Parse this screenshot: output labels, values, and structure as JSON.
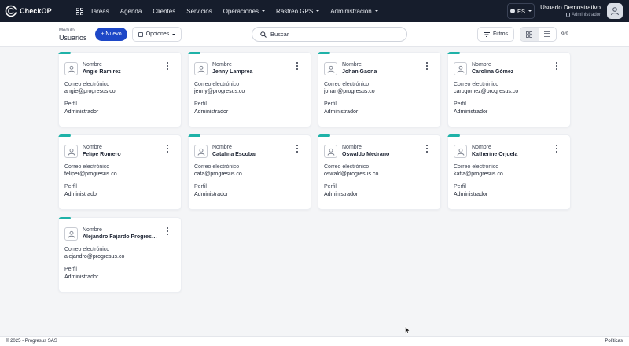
{
  "app": {
    "name": "CheckOP"
  },
  "nav": {
    "items": [
      {
        "label": "Tareas",
        "has_menu": false
      },
      {
        "label": "Agenda",
        "has_menu": false
      },
      {
        "label": "Clientes",
        "has_menu": false
      },
      {
        "label": "Servicios",
        "has_menu": false
      },
      {
        "label": "Operaciones",
        "has_menu": true
      },
      {
        "label": "Rastreo GPS",
        "has_menu": true
      },
      {
        "label": "Administración",
        "has_menu": true
      }
    ],
    "language": "ES",
    "user": {
      "name": "Usuario Demostrativo",
      "role": "Administrador"
    }
  },
  "toolbar": {
    "module_label": "Módulo",
    "module_title": "Usuarios",
    "new_label": "+ Nuevo",
    "options_label": "Opciones",
    "search_placeholder": "Buscar",
    "filters_label": "Filtros",
    "count": "9/9"
  },
  "card_labels": {
    "name": "Nombre",
    "email": "Correo electrónico",
    "profile": "Perfil"
  },
  "users": [
    {
      "name": "Angie Ramirez",
      "email": "angie@progresus.co",
      "profile": "Administrador"
    },
    {
      "name": "Jenny Lamprea",
      "email": "jenny@progresus.co",
      "profile": "Administrador"
    },
    {
      "name": "Johan Gaona",
      "email": "johan@progresus.co",
      "profile": "Administrador"
    },
    {
      "name": "Carolina Gómez",
      "email": "carogomez@progresus.co",
      "profile": "Administrador"
    },
    {
      "name": "Felipe Romero",
      "email": "feliper@progresus.co",
      "profile": "Administrador"
    },
    {
      "name": "Catalina Escobar",
      "email": "cata@progresus.co",
      "profile": "Administrador"
    },
    {
      "name": "Oswaldo Medrano",
      "email": "oswald@progresus.co",
      "profile": "Administrador"
    },
    {
      "name": "Katherine Orjuela",
      "email": "katta@progresus.co",
      "profile": "Administrador"
    },
    {
      "name": "Alejandro Fajardo Progresus",
      "email": "alejandro@progresus.co",
      "profile": "Administrador"
    }
  ],
  "footer": {
    "copyright": "© 2025 - Progresus SAS",
    "policies": "Políticas"
  },
  "colors": {
    "navbar": "#161d2c",
    "primary": "#1d47c7",
    "accent": "#1fb2a8"
  }
}
